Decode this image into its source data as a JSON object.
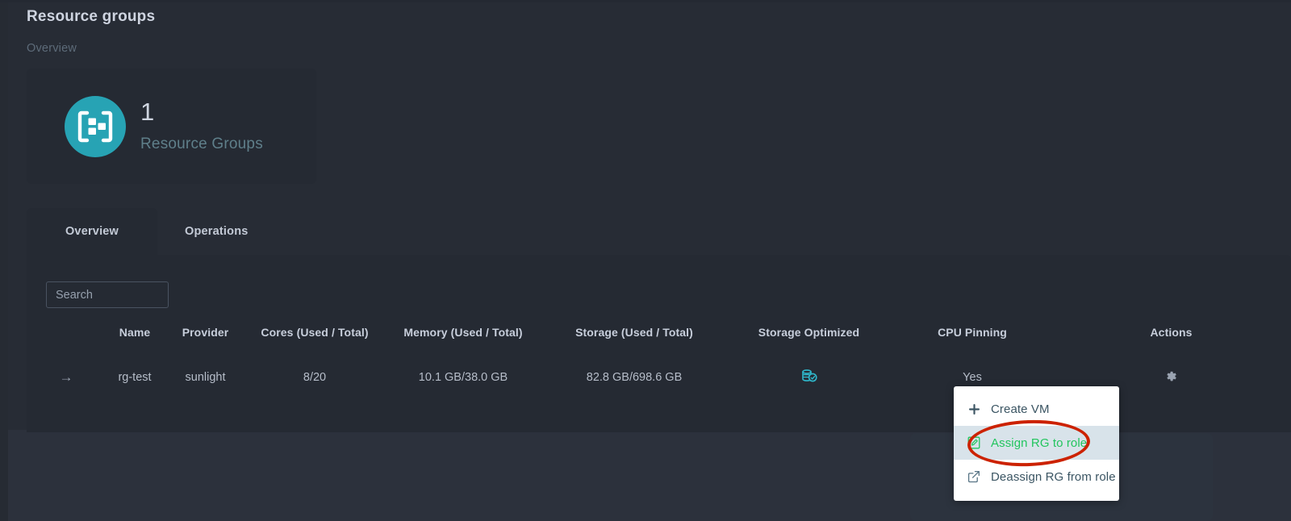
{
  "page": {
    "title": "Resource groups",
    "breadcrumb": "Overview"
  },
  "summary_card": {
    "icon": "resource-group-icon",
    "count": "1",
    "label": "Resource Groups",
    "accent_color": "#27a3b4"
  },
  "tabs": [
    {
      "label": "Overview",
      "active": true
    },
    {
      "label": "Operations",
      "active": false
    }
  ],
  "search": {
    "placeholder": "Search",
    "value": ""
  },
  "table": {
    "columns": [
      "",
      "Name",
      "Provider",
      "Cores (Used / Total)",
      "Memory (Used / Total)",
      "Storage (Used / Total)",
      "Storage Optimized",
      "CPU Pinning",
      "Actions"
    ],
    "rows": [
      {
        "expand_icon": "arrow-right-icon",
        "name": "rg-test",
        "provider": "sunlight",
        "cores": "8/20",
        "memory": "10.1 GB/38.0 GB",
        "storage": "82.8 GB/698.6 GB",
        "storage_optimized_icon": "storage-optimized-icon",
        "cpu_pinning": "Yes",
        "actions_icon": "gear-icon"
      }
    ]
  },
  "context_menu": {
    "items": [
      {
        "label": "Create VM",
        "icon": "plus-icon",
        "highlighted": false
      },
      {
        "label": "Assign RG to role",
        "icon": "assign-role-icon",
        "highlighted": true
      },
      {
        "label": "Deassign RG from role",
        "icon": "external-link-icon",
        "highlighted": false
      }
    ],
    "highlight_text_color": "#22c55e",
    "highlight_bg_color": "#d8e3ea"
  },
  "annotation": {
    "shape": "ellipse",
    "color": "#cc2200",
    "target": "Assign RG to role"
  }
}
